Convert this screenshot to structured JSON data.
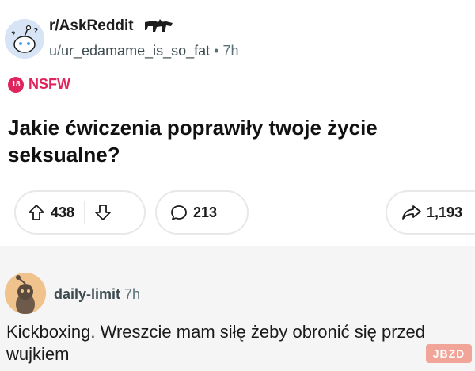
{
  "post": {
    "subreddit": "r/AskReddit",
    "byline_prefix": "u/",
    "username": "ur_edamame_is_so_fat",
    "separator": "•",
    "age": "7h",
    "nsfw_badge": "18",
    "nsfw_label": "NSFW",
    "title": "Jakie ćwiczenia poprawiły twoje życie seksualne?"
  },
  "actions": {
    "upvotes": "438",
    "comments": "213",
    "shares": "1,193"
  },
  "comment": {
    "username": "daily-limit",
    "age": "7h",
    "body": "Kickboxing. Wreszcie mam siłę żeby obronić się przed wujkiem"
  },
  "watermark": "JBZD",
  "colors": {
    "nsfw": "#e0245e",
    "text": "#1a1a1b",
    "muted": "#576f76",
    "comment_bg": "#f5f5f5"
  }
}
